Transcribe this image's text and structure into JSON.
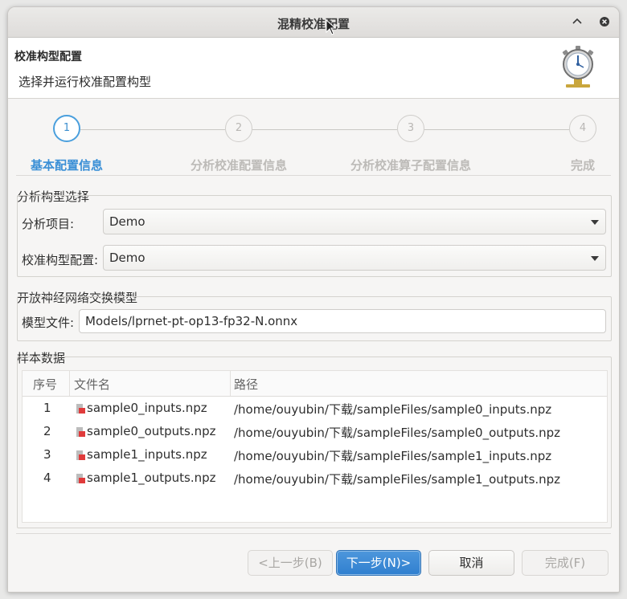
{
  "window": {
    "title": "混精校准配置"
  },
  "header": {
    "title": "校准构型配置",
    "subtitle": "选择并运行校准配置构型"
  },
  "steps": [
    {
      "number": "1",
      "label": "基本配置信息",
      "active": true
    },
    {
      "number": "2",
      "label": "分析校准配置信息",
      "active": false
    },
    {
      "number": "3",
      "label": "分析校准算子配置信息",
      "active": false
    },
    {
      "number": "4",
      "label": "完成",
      "active": false
    }
  ],
  "group_model_select": {
    "title": "分析构型选择",
    "project_label": "分析项目:",
    "project_value": "Demo",
    "config_label": "校准构型配置:",
    "config_value": "Demo"
  },
  "group_onnx": {
    "title": "开放神经网络交换模型",
    "model_label": "模型文件:",
    "model_value": "Models/lprnet-pt-op13-fp32-N.onnx"
  },
  "group_samples": {
    "title": "样本数据",
    "columns": [
      "序号",
      "文件名",
      "路径"
    ],
    "rows": [
      {
        "index": "1",
        "file": "sample0_inputs.npz",
        "path": "/home/ouyubin/下载/sampleFiles/sample0_inputs.npz"
      },
      {
        "index": "2",
        "file": "sample0_outputs.npz",
        "path": "/home/ouyubin/下载/sampleFiles/sample0_outputs.npz"
      },
      {
        "index": "3",
        "file": "sample1_inputs.npz",
        "path": "/home/ouyubin/下载/sampleFiles/sample1_inputs.npz"
      },
      {
        "index": "4",
        "file": "sample1_outputs.npz",
        "path": "/home/ouyubin/下载/sampleFiles/sample1_outputs.npz"
      }
    ]
  },
  "buttons": {
    "back": "<上一步(B)",
    "next": "下一步(N)>",
    "cancel": "取消",
    "finish": "完成(F)"
  },
  "colors": {
    "accent": "#3a8fd6",
    "primary_button": "#3a87d4"
  }
}
